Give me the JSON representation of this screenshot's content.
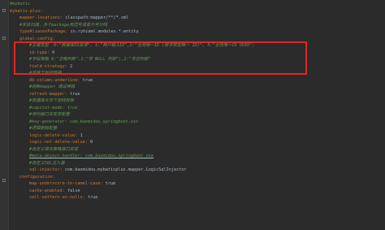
{
  "editor": {
    "lines": [
      {
        "text": "#mybatis",
        "kind": "comment",
        "indent": 0
      },
      {
        "text": "mybatis-plus:",
        "kind": "key",
        "indent": 0
      },
      {
        "text": "mapper-locations: classpath:mapper/**/*.xml",
        "kind": "pair",
        "indent": 1,
        "key": "mapper-locations:",
        "value": " classpath:mapper/**/*.xml"
      },
      {
        "text": "#实体扫描，多个package用逗号或者分号分隔",
        "kind": "comment",
        "indent": 1
      },
      {
        "text": "typeAliasesPackage: co.ryhiaml.modules.*.entity",
        "kind": "pair",
        "indent": 1,
        "key": "typeAliasesPackage:",
        "value": " co.ryhiaml.modules.*.entity"
      },
      {
        "text": "global-config:",
        "kind": "key",
        "indent": 1
      },
      {
        "text": "#主键类型  0:\"数据库ID自增\", 1:\"用户输入ID\",2:\"全局唯一ID (数字类型唯一 ID)\", 3:\"全局唯一ID UUID\";",
        "kind": "comment",
        "indent": 2
      },
      {
        "text": "id-type: 0",
        "kind": "pair",
        "indent": 2,
        "key": "id-type:",
        "value": " 0"
      },
      {
        "text": "#字段策略 0:\"忽略判断\",1:\"非 NULL 判断\"),2:\"非空判断\"",
        "kind": "comment",
        "indent": 2
      },
      {
        "text": "field-strategy: 2",
        "kind": "pair",
        "indent": 2,
        "key": "field-strategy:",
        "value": " 2"
      },
      {
        "text": "#驼峰下划线转换",
        "kind": "comment",
        "indent": 2
      },
      {
        "text": "db-column-underline: true",
        "kind": "pair",
        "indent": 2,
        "key": "db-column-underline:",
        "value": " true"
      },
      {
        "text": "#刷新mapper 调试神器",
        "kind": "comment",
        "indent": 2
      },
      {
        "text": "refresh-mapper: true",
        "kind": "pair",
        "indent": 2,
        "key": "refresh-mapper:",
        "value": " true"
      },
      {
        "text": "#数据库大写下划线转换",
        "kind": "comment",
        "indent": 2
      },
      {
        "text": "#capital-mode: true",
        "kind": "comment",
        "indent": 2
      },
      {
        "text": "#序列接口实现类配置",
        "kind": "comment",
        "indent": 2
      },
      {
        "text": "#key-generator: com.baomidou.springboot.xxx",
        "kind": "comment",
        "indent": 2
      },
      {
        "text": "#逻辑删除配置",
        "kind": "comment",
        "indent": 2
      },
      {
        "text": "logic-delete-value: 1",
        "kind": "pair",
        "indent": 2,
        "key": "logic-delete-value:",
        "value": " 1"
      },
      {
        "text": "logic-not-delete-value: 0",
        "kind": "pair",
        "indent": 2,
        "key": "logic-not-delete-value:",
        "value": " 0"
      },
      {
        "text": "#自定义填充策略接口实现",
        "kind": "comment",
        "indent": 2
      },
      {
        "text": "#meta-object-handler: com.baomidou.springboot.xxx",
        "kind": "comment",
        "indent": 2
      },
      {
        "text": "#自定义SQL注入器",
        "kind": "comment",
        "indent": 2
      },
      {
        "text": "sql-injector: com.baomidou.mybatisplus.mapper.LogicSqlInjector",
        "kind": "pair",
        "indent": 2,
        "key": "sql-injector:",
        "value": " com.baomidou.mybatisplus.mapper.LogicSqlInjector"
      },
      {
        "text": "configuration:",
        "kind": "key",
        "indent": 1
      },
      {
        "text": "map-underscore-to-camel-case: true",
        "kind": "pair",
        "indent": 2,
        "key": "map-underscore-to-camel-case:",
        "value": " true"
      },
      {
        "text": "cache-enabled: false",
        "kind": "pair",
        "indent": 2,
        "key": "cache-enabled:",
        "value": " false"
      },
      {
        "text": "call-setters-on-nulls: true",
        "kind": "pair",
        "indent": 2,
        "key": "call-setters-on-nulls:",
        "value": " true"
      }
    ]
  },
  "colors": {
    "background": "#2b2b2b",
    "comment": "#629755",
    "key": "#cc7832",
    "value": "#a9b7c6",
    "highlight_border": "#e02525"
  }
}
